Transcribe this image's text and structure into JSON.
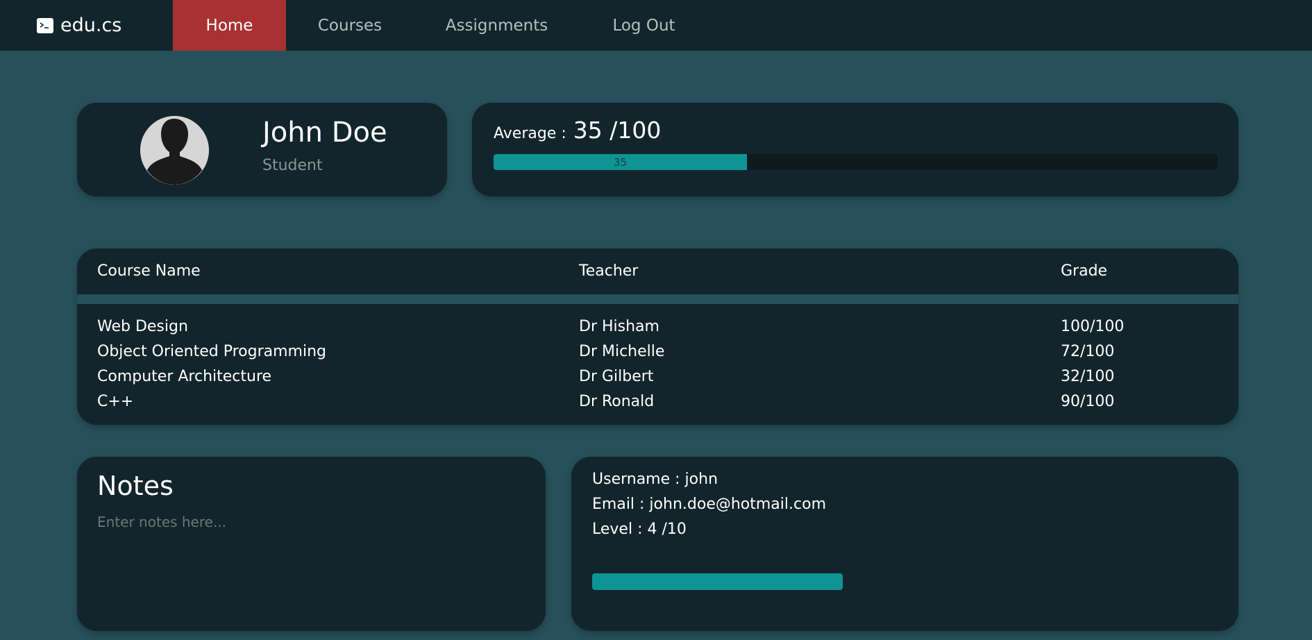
{
  "nav": {
    "brand": "edu.cs",
    "items": [
      {
        "label": "Home",
        "active": true
      },
      {
        "label": "Courses",
        "active": false
      },
      {
        "label": "Assignments",
        "active": false
      },
      {
        "label": "Log Out",
        "active": false
      }
    ]
  },
  "profile": {
    "name": "John Doe",
    "role": "Student",
    "avatar_icon": "user-silhouette-icon"
  },
  "average": {
    "label": "Average :",
    "value_text": "35 /100",
    "bar_label": "35",
    "percent": 35
  },
  "courses": {
    "headers": [
      "Course Name",
      "Teacher",
      "Grade"
    ],
    "rows": [
      {
        "course": "Web Design",
        "teacher": "Dr Hisham",
        "grade": "100/100"
      },
      {
        "course": "Object Oriented Programming",
        "teacher": "Dr Michelle",
        "grade": "72/100"
      },
      {
        "course": "Computer Architecture",
        "teacher": "Dr Gilbert",
        "grade": "32/100"
      },
      {
        "course": "C++",
        "teacher": "Dr Ronald",
        "grade": "90/100"
      }
    ]
  },
  "notes": {
    "title": "Notes",
    "placeholder": "Enter notes here..."
  },
  "account": {
    "username": "Username : john",
    "email": "Email : john.doe@hotmail.com",
    "level": "Level : 4 /10",
    "level_fraction": 0.4
  },
  "colors": {
    "background": "#27505c",
    "card": "#13252c",
    "accent": "#0f9494",
    "active_nav": "#a93131"
  }
}
